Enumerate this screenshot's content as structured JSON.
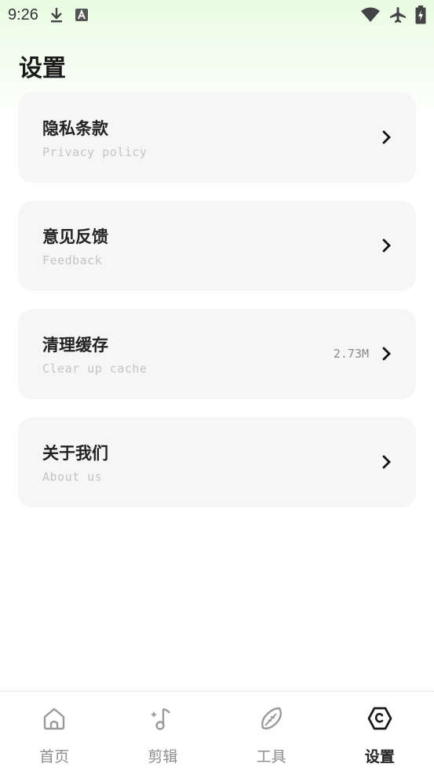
{
  "status_bar": {
    "time": "9:26",
    "left_icons": [
      "download-icon",
      "a-box-icon"
    ],
    "right_icons": [
      "wifi-icon",
      "airplane-icon",
      "battery-icon"
    ]
  },
  "page": {
    "title": "设置"
  },
  "settings": [
    {
      "title": "隐私条款",
      "subtitle": "Privacy policy",
      "value": ""
    },
    {
      "title": "意见反馈",
      "subtitle": "Feedback",
      "value": ""
    },
    {
      "title": "清理缓存",
      "subtitle": "Clear up cache",
      "value": "2.73M"
    },
    {
      "title": "关于我们",
      "subtitle": "About us",
      "value": ""
    }
  ],
  "bottom_nav": {
    "active": "设置",
    "items": [
      {
        "label": "首页",
        "icon": "home-icon"
      },
      {
        "label": "剪辑",
        "icon": "music-note-icon"
      },
      {
        "label": "工具",
        "icon": "leaf-icon"
      },
      {
        "label": "设置",
        "icon": "settings-hex-icon"
      }
    ]
  },
  "colors": {
    "accent_active": "#222222",
    "inactive": "#8d8d8d",
    "card_bg": "#f6f6f6",
    "header_tint": "#e9fbe3"
  }
}
